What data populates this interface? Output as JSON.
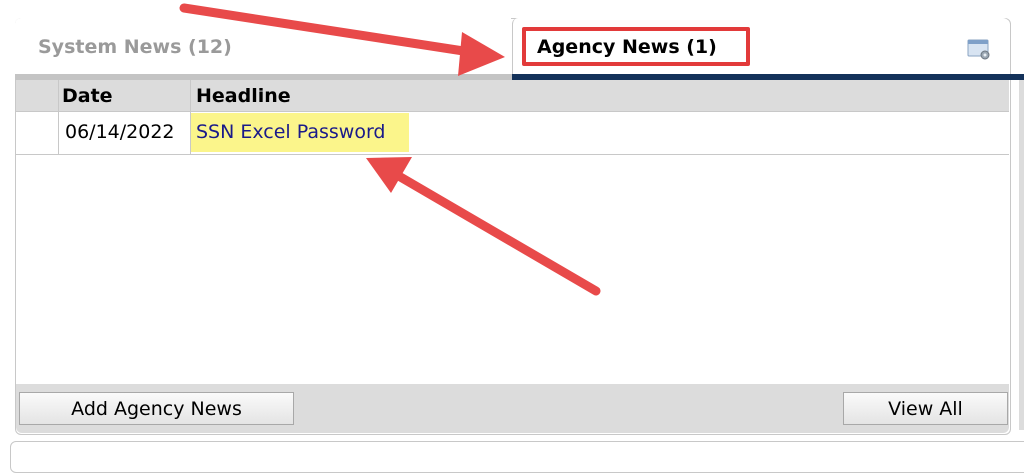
{
  "tabs": [
    {
      "label": "System News (12)",
      "active": false
    },
    {
      "label": "Agency News (1)",
      "active": true
    }
  ],
  "settings_icon": "window-settings-icon",
  "table": {
    "columns": [
      "Date",
      "Headline"
    ],
    "rows": [
      {
        "date": "06/14/2022",
        "headline": "SSN Excel Password"
      }
    ]
  },
  "footer": {
    "add_label": "Add Agency News",
    "view_all_label": "View All"
  },
  "colors": {
    "active_tab_underline": "#14325a",
    "annotation": "#e23a3a",
    "highlight": "#fbf58b",
    "link": "#1a1a8a"
  }
}
